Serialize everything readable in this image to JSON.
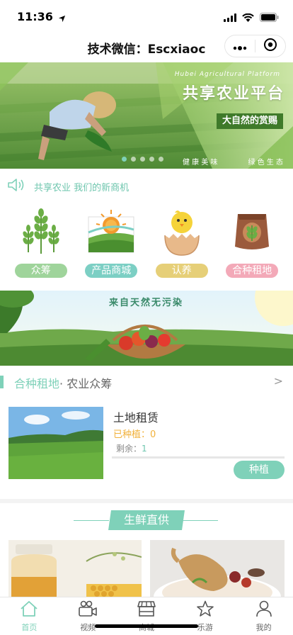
{
  "status_bar": {
    "time": "11:36"
  },
  "nav": {
    "title": "技术微信：Escxiaoc"
  },
  "banner": {
    "subtitle": "Hubei Agricultural Platform",
    "title": "共享农业平台",
    "slogan": "大自然的赏赐",
    "left_tagline": "健 康 美 味",
    "right_tagline": "绿 色 生 态",
    "dots": 5,
    "active_dot": 0
  },
  "notice": {
    "text": "共享农业 我们的新商机"
  },
  "categories": [
    {
      "label": "众筹",
      "icon": "wheat-icon",
      "color": "#9fd49b"
    },
    {
      "label": "产品商城",
      "icon": "sunrise-field-icon",
      "color": "#7ccfc4"
    },
    {
      "label": "认养",
      "icon": "chick-egg-icon",
      "color": "#e6cf78"
    },
    {
      "label": "合种租地",
      "icon": "seed-bag-icon",
      "color": "#f3a9b8"
    }
  ],
  "banner2": {
    "text": "来自天然无污染"
  },
  "section": {
    "title": "合种租地",
    "subtitle": "· 农业众筹",
    "arrow": ">"
  },
  "item": {
    "title": "土地租赁",
    "planted": "已种植：0",
    "remain_label": "剩余：",
    "remain_value": "1",
    "button": "种植"
  },
  "fresh": {
    "title": "生鲜直供"
  },
  "tabs": [
    {
      "label": "首页",
      "icon": "home-icon",
      "active": true
    },
    {
      "label": "视频",
      "icon": "video-camera-icon",
      "active": false
    },
    {
      "label": "商城",
      "icon": "shop-icon",
      "active": false
    },
    {
      "label": "乐游",
      "icon": "star-icon",
      "active": false
    },
    {
      "label": "我的",
      "icon": "user-icon",
      "active": false
    }
  ],
  "colors": {
    "accent": "#7fd1b9",
    "warning": "#f1b13b"
  }
}
